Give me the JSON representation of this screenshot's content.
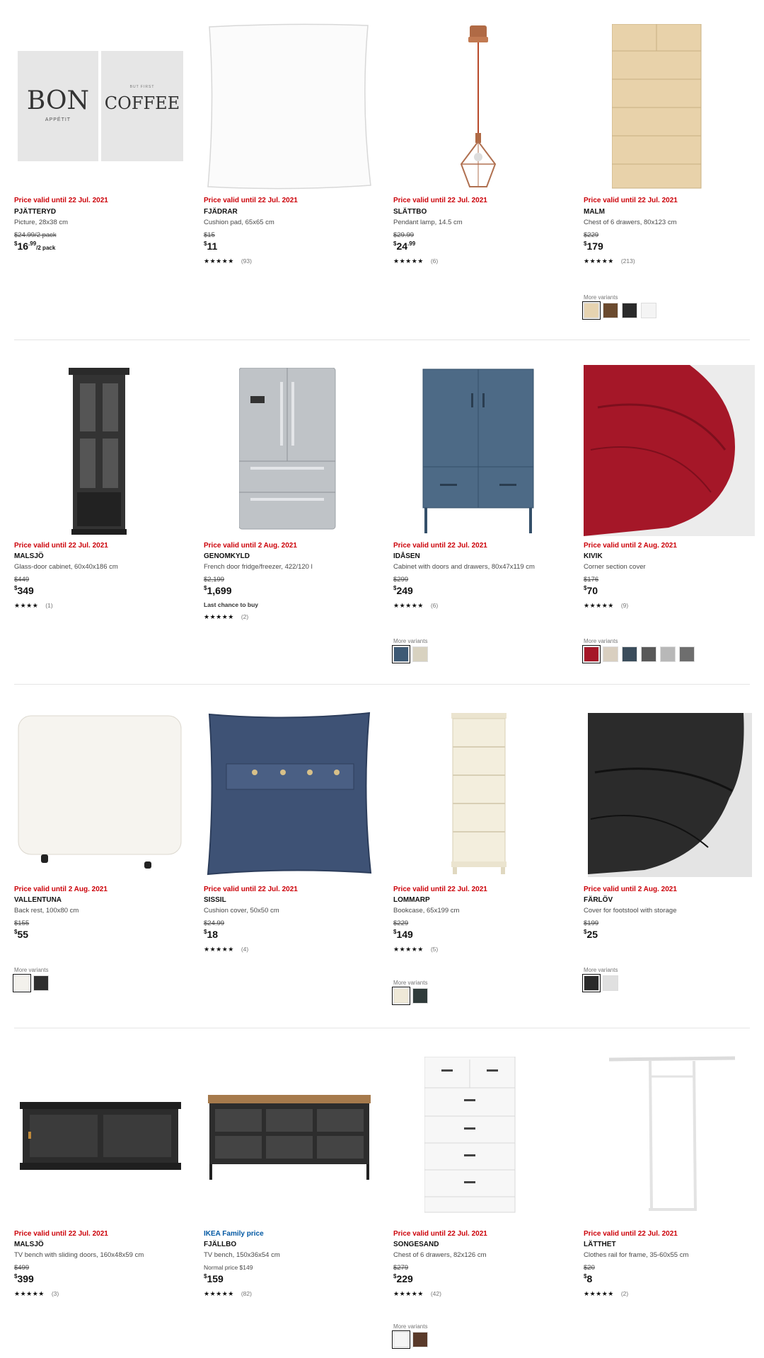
{
  "rows": [
    {
      "products": [
        {
          "label": "Price valid until 22 Jul. 2021",
          "label_type": "red",
          "name": "PJÄTTERYD",
          "desc": "Picture, 28x38 cm",
          "old_price": "$24.99/2 pack",
          "price_cur": "$",
          "price_int": "16",
          "price_dec": ".99",
          "price_suf": "/2 pack",
          "rating": "",
          "count": "",
          "poster_left": "BON",
          "poster_left_sub": "APPÉTIT",
          "poster_right_small": "BUT FIRST",
          "poster_right": "COFFEE"
        },
        {
          "label": "Price valid until 22 Jul. 2021",
          "label_type": "red",
          "name": "FJÄDRAR",
          "desc": "Cushion pad, 65x65 cm",
          "old_price": "$15",
          "price_cur": "$",
          "price_int": "11",
          "rating": "★★★★★",
          "count": "(93)"
        },
        {
          "label": "Price valid until 22 Jul. 2021",
          "label_type": "red",
          "name": "SLÄTTBO",
          "desc": "Pendant lamp, 14.5 cm",
          "old_price": "$29.99",
          "price_cur": "$",
          "price_int": "24",
          "price_dec": ".99",
          "rating": "★★★★★",
          "count": "(6)"
        },
        {
          "label": "Price valid until 22 Jul. 2021",
          "label_type": "red",
          "name": "MALM",
          "desc": "Chest of 6 drawers, 80x123 cm",
          "old_price": "$229",
          "price_cur": "$",
          "price_int": "179",
          "rating": "★★★★★",
          "count": "(213)",
          "variants_label": "More variants",
          "variants": [
            "#e6d3b0",
            "#6b4a2e",
            "#2b2b2b",
            "#f4f4f4"
          ]
        }
      ]
    },
    {
      "products": [
        {
          "label": "Price valid until 22 Jul. 2021",
          "label_type": "red",
          "name": "MALSJÖ",
          "desc": "Glass-door cabinet, 60x40x186 cm",
          "old_price": "$449",
          "price_cur": "$",
          "price_int": "349",
          "rating": "★★★★",
          "count": "(1)"
        },
        {
          "label": "Price valid until 2 Aug. 2021",
          "label_type": "red",
          "name": "GENOMKYLD",
          "desc": "French door fridge/freezer, 422/120 l",
          "old_price": "$2,199",
          "price_cur": "$",
          "price_int": "1,699",
          "last_chance": "Last chance to buy",
          "rating": "★★★★★",
          "count": "(2)"
        },
        {
          "label": "Price valid until 22 Jul. 2021",
          "label_type": "red",
          "name": "IDÅSEN",
          "desc": "Cabinet with doors and drawers, 80x47x119 cm",
          "old_price": "$299",
          "price_cur": "$",
          "price_int": "249",
          "rating": "★★★★★",
          "count": "(6)",
          "variants_label": "More variants",
          "variants": [
            "#3e5a75",
            "#d8d2c0"
          ]
        },
        {
          "label": "Price valid until 2 Aug. 2021",
          "label_type": "red",
          "name": "KIVIK",
          "desc": "Corner section cover",
          "old_price": "$176",
          "price_cur": "$",
          "price_int": "70",
          "rating": "★★★★★",
          "count": "(9)",
          "variants_label": "More variants",
          "variants": [
            "#a51728",
            "#d9cfc0",
            "#3b4d5c",
            "#595959",
            "#b8b8b8",
            "#6e6e6e"
          ]
        }
      ]
    },
    {
      "products": [
        {
          "label": "Price valid until 2 Aug. 2021",
          "label_type": "red",
          "name": "VALLENTUNA",
          "desc": "Back rest, 100x80 cm",
          "old_price": "$155",
          "price_cur": "$",
          "price_int": "55",
          "rating": "",
          "count": "",
          "variants_label": "More variants",
          "variants": [
            "#f3f1ec",
            "#2e2e2e"
          ]
        },
        {
          "label": "Price valid until 22 Jul. 2021",
          "label_type": "red",
          "name": "SISSIL",
          "desc": "Cushion cover, 50x50 cm",
          "old_price": "$24.99",
          "price_cur": "$",
          "price_int": "18",
          "rating": "★★★★★",
          "count": "(4)"
        },
        {
          "label": "Price valid until 22 Jul. 2021",
          "label_type": "red",
          "name": "LOMMARP",
          "desc": "Bookcase, 65x199 cm",
          "old_price": "$229",
          "price_cur": "$",
          "price_int": "149",
          "rating": "★★★★★",
          "count": "(5)",
          "variants_label": "More variants",
          "variants": [
            "#efe9d8",
            "#2f3b3a"
          ]
        },
        {
          "label": "Price valid until 2 Aug. 2021",
          "label_type": "red",
          "name": "FÄRLÖV",
          "desc": "Cover for footstool with storage",
          "old_price": "$199",
          "price_cur": "$",
          "price_int": "25",
          "rating": "",
          "count": "",
          "variants_label": "More variants",
          "variants": [
            "#2a2a2a",
            "#e0e0e0"
          ]
        }
      ]
    },
    {
      "products": [
        {
          "label": "Price valid until 22 Jul. 2021",
          "label_type": "red",
          "name": "MALSJÖ",
          "desc": "TV bench with sliding doors, 160x48x59 cm",
          "old_price": "$499",
          "price_cur": "$",
          "price_int": "399",
          "rating": "★★★★★",
          "count": "(3)"
        },
        {
          "label": "IKEA Family price",
          "label_type": "blue",
          "name": "FJÄLLBO",
          "desc": "TV bench, 150x36x54 cm",
          "normal_price": "Normal price $149",
          "price_cur": "$",
          "price_int": "159",
          "rating": "★★★★★",
          "count": "(82)"
        },
        {
          "label": "Price valid until 22 Jul. 2021",
          "label_type": "red",
          "name": "SONGESAND",
          "desc": "Chest of 6 drawers, 82x126 cm",
          "old_price": "$279",
          "price_cur": "$",
          "price_int": "229",
          "rating": "★★★★★",
          "count": "(42)",
          "variants_label": "More variants",
          "variants": [
            "#f5f5f5",
            "#5a3a2a"
          ]
        },
        {
          "label": "Price valid until 22 Jul. 2021",
          "label_type": "red",
          "name": "LÄTTHET",
          "desc": "Clothes rail for frame, 35-60x55 cm",
          "old_price": "$20",
          "price_cur": "$",
          "price_int": "8",
          "rating": "★★★★★",
          "count": "(2)"
        }
      ]
    }
  ]
}
